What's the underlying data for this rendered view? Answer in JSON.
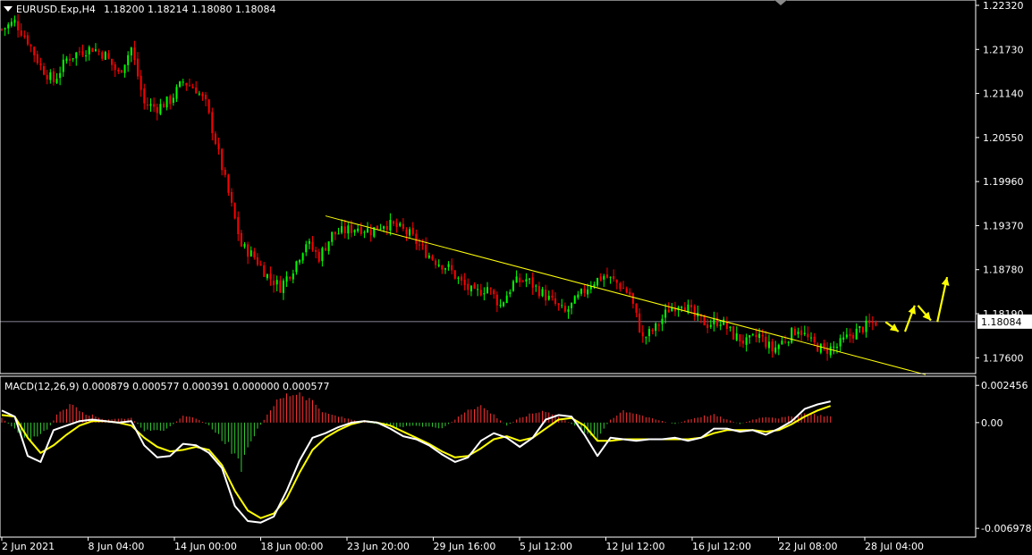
{
  "header": {
    "symbol_label": "EURUSD.Exp,H4",
    "ohlc_text": "1.18200 1.18214 1.18080 1.18084"
  },
  "indicator": {
    "label": "MACD(12,26,9) 0.000879 0.000577 0.000391 0.000000 0.000577"
  },
  "colors": {
    "background": "#000000",
    "bull": "#00ff00",
    "bear": "#ff0000",
    "axis": "#ffffff",
    "trendline": "#ffff00",
    "arrow": "#ffff00",
    "macd_line": "#ffffff",
    "signal_line": "#ffff00",
    "hist_pos": "#ff3333",
    "hist_neg": "#33cc33",
    "current_price_line": "#b0b0c8"
  },
  "chart_data": [
    {
      "type": "candlestick",
      "symbol": "EURUSD.Exp",
      "timeframe": "H4",
      "ylim": [
        1.174,
        1.2238
      ],
      "ytick_labels": [
        "1.22320",
        "1.21730",
        "1.21140",
        "1.20550",
        "1.19960",
        "1.19370",
        "1.18780",
        "1.18190",
        "1.17600"
      ],
      "current_price": "1.18084",
      "xtick_labels": [
        "2 Jun 2021",
        "8 Jun 04:00",
        "14 Jun 00:00",
        "18 Jun 00:00",
        "23 Jun 20:00",
        "29 Jun 16:00",
        "5 Jul 12:00",
        "12 Jul 12:00",
        "16 Jul 12:00",
        "22 Jul 08:00",
        "28 Jul 04:00"
      ],
      "close_path": [
        [
          0,
          1.22
        ],
        [
          4,
          1.221
        ],
        [
          8,
          1.2185
        ],
        [
          12,
          1.215
        ],
        [
          16,
          1.213
        ],
        [
          20,
          1.216
        ],
        [
          24,
          1.217
        ],
        [
          28,
          1.2175
        ],
        [
          32,
          1.2165
        ],
        [
          36,
          1.214
        ],
        [
          40,
          1.2175
        ],
        [
          44,
          1.21
        ],
        [
          48,
          1.2095
        ],
        [
          52,
          1.2105
        ],
        [
          56,
          1.213
        ],
        [
          60,
          1.212
        ],
        [
          63,
          1.21
        ],
        [
          66,
          1.205
        ],
        [
          70,
          1.198
        ],
        [
          74,
          1.191
        ],
        [
          78,
          1.1895
        ],
        [
          82,
          1.187
        ],
        [
          86,
          1.1855
        ],
        [
          90,
          1.188
        ],
        [
          94,
          1.1915
        ],
        [
          98,
          1.1895
        ],
        [
          102,
          1.1925
        ],
        [
          106,
          1.193
        ],
        [
          110,
          1.1935
        ],
        [
          114,
          1.193
        ],
        [
          118,
          1.194
        ],
        [
          122,
          1.1935
        ],
        [
          126,
          1.1925
        ],
        [
          130,
          1.1905
        ],
        [
          134,
          1.189
        ],
        [
          138,
          1.188
        ],
        [
          142,
          1.186
        ],
        [
          146,
          1.1845
        ],
        [
          150,
          1.1855
        ],
        [
          154,
          1.183
        ],
        [
          158,
          1.186
        ],
        [
          162,
          1.1865
        ],
        [
          166,
          1.185
        ],
        [
          170,
          1.1835
        ],
        [
          174,
          1.182
        ],
        [
          178,
          1.184
        ],
        [
          182,
          1.186
        ],
        [
          186,
          1.187
        ],
        [
          190,
          1.186
        ],
        [
          194,
          1.1845
        ],
        [
          198,
          1.1785
        ],
        [
          202,
          1.18
        ],
        [
          206,
          1.1825
        ],
        [
          210,
          1.1835
        ],
        [
          214,
          1.1815
        ],
        [
          218,
          1.1805
        ],
        [
          222,
          1.181
        ],
        [
          226,
          1.179
        ],
        [
          230,
          1.178
        ],
        [
          234,
          1.179
        ],
        [
          238,
          1.177
        ],
        [
          242,
          1.1785
        ],
        [
          246,
          1.18
        ],
        [
          250,
          1.178
        ],
        [
          254,
          1.177
        ],
        [
          258,
          1.1775
        ],
        [
          262,
          1.179
        ],
        [
          266,
          1.18
        ],
        [
          270,
          1.1808
        ]
      ],
      "trendline": [
        [
          100,
          1.195
        ],
        [
          270,
          1.1755
        ]
      ],
      "forecast_arrows": [
        [
          [
            273,
            1.1808
          ],
          [
            277,
            1.1795
          ]
        ],
        [
          [
            279,
            1.1795
          ],
          [
            282,
            1.183
          ]
        ],
        [
          [
            283,
            1.183
          ],
          [
            287,
            1.181
          ]
        ],
        [
          [
            289,
            1.1808
          ],
          [
            292,
            1.1868
          ]
        ]
      ],
      "xlim": [
        0,
        300
      ],
      "grid": false
    },
    {
      "type": "macd",
      "params": "12,26,9",
      "ytick_labels": [
        "0.002456",
        "0.00",
        "-0.006978"
      ],
      "ylim": [
        -0.0075,
        0.003
      ],
      "xlim": [
        0,
        300
      ],
      "macd_path": [
        [
          0,
          0.0008
        ],
        [
          4,
          0.0004
        ],
        [
          8,
          -0.0022
        ],
        [
          12,
          -0.0026
        ],
        [
          16,
          -0.0005
        ],
        [
          20,
          -0.0002
        ],
        [
          24,
          0.0001
        ],
        [
          28,
          0.0002
        ],
        [
          32,
          0.0001
        ],
        [
          36,
          0.0
        ],
        [
          40,
          0.0001
        ],
        [
          44,
          -0.0015
        ],
        [
          48,
          -0.0023
        ],
        [
          52,
          -0.0022
        ],
        [
          56,
          -0.0014
        ],
        [
          60,
          -0.0015
        ],
        [
          64,
          -0.002
        ],
        [
          68,
          -0.003
        ],
        [
          72,
          -0.0055
        ],
        [
          76,
          -0.0065
        ],
        [
          80,
          -0.0066
        ],
        [
          84,
          -0.0062
        ],
        [
          88,
          -0.0045
        ],
        [
          92,
          -0.0025
        ],
        [
          96,
          -0.001
        ],
        [
          100,
          -0.0007
        ],
        [
          104,
          -0.0003
        ],
        [
          108,
          0.0
        ],
        [
          112,
          0.0001
        ],
        [
          116,
          0.0
        ],
        [
          120,
          -0.0004
        ],
        [
          124,
          -0.0009
        ],
        [
          128,
          -0.0011
        ],
        [
          132,
          -0.0015
        ],
        [
          136,
          -0.0021
        ],
        [
          140,
          -0.0026
        ],
        [
          144,
          -0.0023
        ],
        [
          148,
          -0.0012
        ],
        [
          152,
          -0.0007
        ],
        [
          156,
          -0.001
        ],
        [
          160,
          -0.0016
        ],
        [
          164,
          -0.001
        ],
        [
          168,
          0.0002
        ],
        [
          172,
          0.0005
        ],
        [
          176,
          0.0004
        ],
        [
          180,
          -0.0008
        ],
        [
          184,
          -0.0022
        ],
        [
          188,
          -0.001
        ],
        [
          192,
          -0.0011
        ],
        [
          196,
          -0.0012
        ],
        [
          200,
          -0.0011
        ],
        [
          204,
          -0.0011
        ],
        [
          208,
          -0.001
        ],
        [
          212,
          -0.0012
        ],
        [
          216,
          -0.001
        ],
        [
          220,
          -0.0004
        ],
        [
          224,
          -0.0004
        ],
        [
          228,
          -0.0006
        ],
        [
          232,
          -0.0005
        ],
        [
          236,
          -0.0008
        ],
        [
          240,
          -0.0004
        ],
        [
          244,
          0.0001
        ],
        [
          248,
          0.0009
        ],
        [
          252,
          0.0012
        ],
        [
          256,
          0.0014
        ]
      ],
      "signal_path": [
        [
          0,
          0.0005
        ],
        [
          4,
          0.0004
        ],
        [
          8,
          -0.001
        ],
        [
          12,
          -0.002
        ],
        [
          16,
          -0.0015
        ],
        [
          20,
          -0.0008
        ],
        [
          24,
          -0.0002
        ],
        [
          28,
          0.0001
        ],
        [
          32,
          0.0001
        ],
        [
          36,
          0.0
        ],
        [
          40,
          -0.0002
        ],
        [
          44,
          -0.001
        ],
        [
          48,
          -0.0016
        ],
        [
          52,
          -0.0019
        ],
        [
          56,
          -0.0018
        ],
        [
          60,
          -0.0016
        ],
        [
          64,
          -0.0018
        ],
        [
          68,
          -0.0028
        ],
        [
          72,
          -0.0045
        ],
        [
          76,
          -0.0058
        ],
        [
          80,
          -0.0063
        ],
        [
          84,
          -0.006
        ],
        [
          88,
          -0.005
        ],
        [
          92,
          -0.0033
        ],
        [
          96,
          -0.0018
        ],
        [
          100,
          -0.001
        ],
        [
          104,
          -0.0005
        ],
        [
          108,
          -0.0001
        ],
        [
          112,
          0.0001
        ],
        [
          116,
          0.0
        ],
        [
          120,
          -0.0002
        ],
        [
          124,
          -0.0006
        ],
        [
          128,
          -0.001
        ],
        [
          132,
          -0.0014
        ],
        [
          136,
          -0.0019
        ],
        [
          140,
          -0.0023
        ],
        [
          144,
          -0.0022
        ],
        [
          148,
          -0.0017
        ],
        [
          152,
          -0.0011
        ],
        [
          156,
          -0.0009
        ],
        [
          160,
          -0.0012
        ],
        [
          164,
          -0.001
        ],
        [
          168,
          -0.0004
        ],
        [
          172,
          0.0002
        ],
        [
          176,
          0.0003
        ],
        [
          180,
          -0.0002
        ],
        [
          184,
          -0.0012
        ],
        [
          188,
          -0.0012
        ],
        [
          192,
          -0.0011
        ],
        [
          196,
          -0.0011
        ],
        [
          200,
          -0.0011
        ],
        [
          204,
          -0.0011
        ],
        [
          208,
          -0.0011
        ],
        [
          212,
          -0.0011
        ],
        [
          216,
          -0.001
        ],
        [
          220,
          -0.0007
        ],
        [
          224,
          -0.0005
        ],
        [
          228,
          -0.0005
        ],
        [
          232,
          -0.0005
        ],
        [
          236,
          -0.0006
        ],
        [
          240,
          -0.0005
        ],
        [
          244,
          -0.0001
        ],
        [
          248,
          0.0004
        ],
        [
          252,
          0.0008
        ],
        [
          256,
          0.0011
        ]
      ],
      "histogram_path": [
        [
          0,
          0.0003
        ],
        [
          8,
          -0.0012
        ],
        [
          14,
          -0.0005
        ],
        [
          18,
          0.0008
        ],
        [
          22,
          0.0012
        ],
        [
          26,
          0.0006
        ],
        [
          32,
          0.0002
        ],
        [
          40,
          0.0003
        ],
        [
          44,
          -0.0005
        ],
        [
          50,
          -0.0006
        ],
        [
          56,
          0.0004
        ],
        [
          60,
          0.0003
        ],
        [
          64,
          -0.0002
        ],
        [
          70,
          -0.0015
        ],
        [
          74,
          -0.003
        ],
        [
          78,
          -0.0008
        ],
        [
          84,
          0.0012
        ],
        [
          88,
          0.0018
        ],
        [
          92,
          0.002
        ],
        [
          96,
          0.0014
        ],
        [
          100,
          0.0006
        ],
        [
          104,
          0.0004
        ],
        [
          110,
          0.0001
        ],
        [
          116,
          -0.0001
        ],
        [
          122,
          -0.0003
        ],
        [
          128,
          -0.0002
        ],
        [
          132,
          -0.0003
        ],
        [
          136,
          -0.0004
        ],
        [
          140,
          0.0002
        ],
        [
          144,
          0.0009
        ],
        [
          148,
          0.0011
        ],
        [
          152,
          0.0005
        ],
        [
          156,
          -0.0002
        ],
        [
          160,
          0.0003
        ],
        [
          164,
          0.0006
        ],
        [
          168,
          0.0008
        ],
        [
          172,
          0.0004
        ],
        [
          176,
          -0.0001
        ],
        [
          180,
          -0.0006
        ],
        [
          184,
          -0.001
        ],
        [
          188,
          0.0002
        ],
        [
          192,
          0.0008
        ],
        [
          196,
          0.0006
        ],
        [
          200,
          0.0003
        ],
        [
          204,
          0.0001
        ],
        [
          208,
          -0.0001
        ],
        [
          212,
          0.0002
        ],
        [
          216,
          0.0004
        ],
        [
          220,
          0.0005
        ],
        [
          224,
          0.0002
        ],
        [
          228,
          -0.0001
        ],
        [
          232,
          0.0002
        ],
        [
          236,
          0.0004
        ],
        [
          240,
          0.0003
        ],
        [
          244,
          0.0004
        ],
        [
          248,
          0.0006
        ],
        [
          252,
          0.0005
        ],
        [
          256,
          0.0004
        ]
      ],
      "grid": false
    }
  ]
}
